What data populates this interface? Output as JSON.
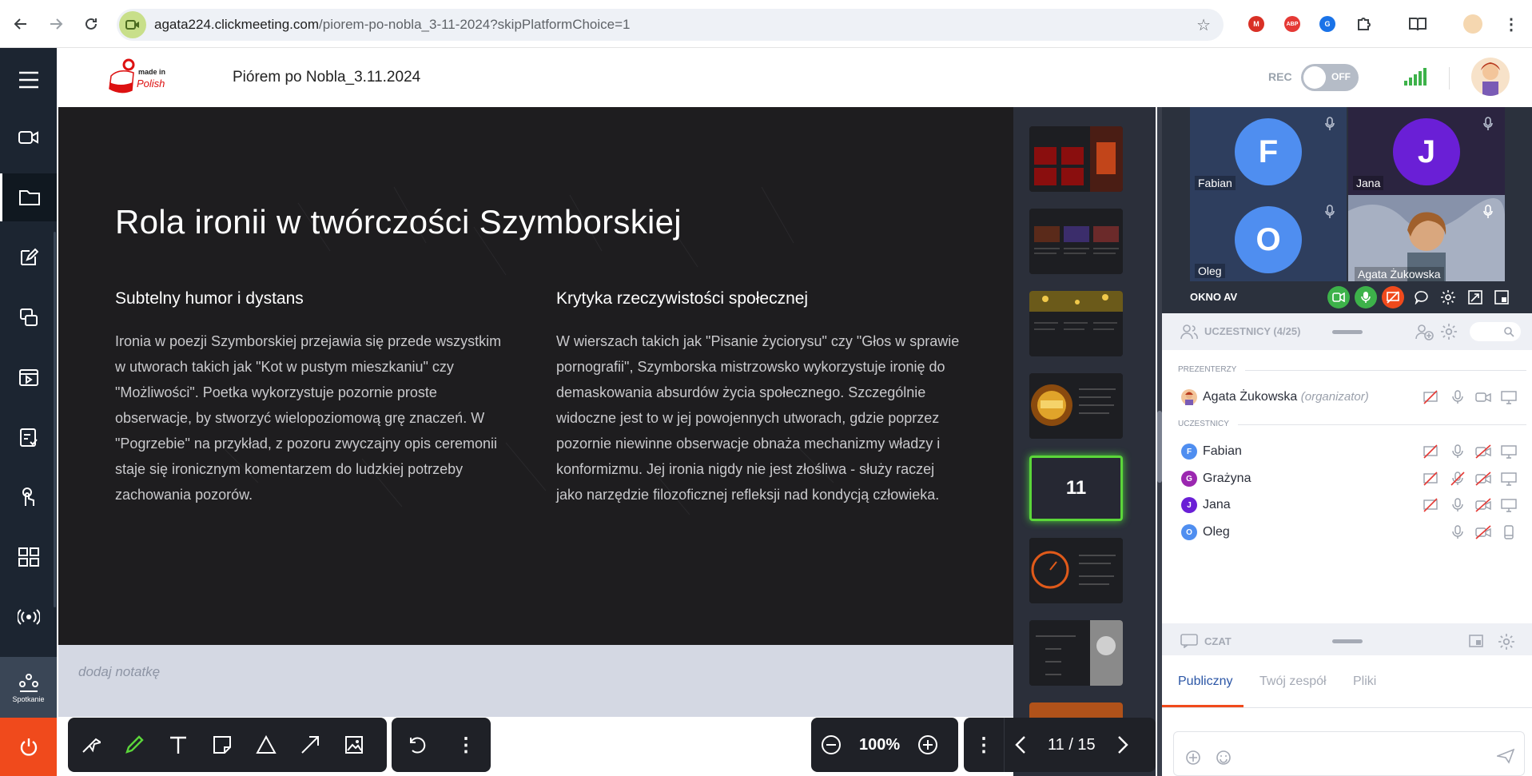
{
  "browser": {
    "url_host": "agata224.clickmeeting.com",
    "url_path": "/piorem-po-nobla_3-11-2024?skipPlatformChoice=1",
    "extensions": [
      {
        "name": "gmail-icon",
        "label": "M",
        "color": "#d93025"
      },
      {
        "name": "adblock-icon",
        "label": "ABP",
        "color": "#e53935"
      },
      {
        "name": "translate-icon",
        "label": "G",
        "color": "#1a73e8"
      }
    ]
  },
  "header": {
    "logo_text_top": "made in",
    "logo_text_bottom": "Polish",
    "meeting_title": "Piórem po Nobla_3.11.2024",
    "rec_label": "REC",
    "rec_state": "OFF"
  },
  "sidebar": {
    "spotkanie_label": "Spotkanie"
  },
  "slide": {
    "title": "Rola ironii w twórczości Szymborskiej",
    "left_heading": "Subtelny humor i dystans",
    "left_body": "Ironia w poezji Szymborskiej przejawia się przede wszystkim w utworach takich jak \"Kot w pustym mieszkaniu\" czy \"Możliwości\". Poetka wykorzystuje pozornie proste obserwacje, by stworzyć wielopoziomową grę znaczeń. W \"Pogrzebie\" na przykład, z pozoru zwyczajny opis ceremonii staje się ironicznym komentarzem do ludzkiej potrzeby zachowania pozorów.",
    "right_heading": "Krytyka rzeczywistości społecznej",
    "right_body": "W wierszach takich jak \"Pisanie życiorysu\" czy \"Głos w sprawie pornografii\", Szymborska mistrzowsko wykorzystuje ironię do demaskowania absurdów życia społecznego. Szczególnie widoczne jest to w jej powojennych utworach, gdzie poprzez pozornie niewinne obserwacje obnaża mechanizmy władzy i konformizmu. Jej ironia nigdy nie jest złośliwa - służy raczej jako narzędzie filozoficznej refleksji nad kondycją człowieka."
  },
  "notes": {
    "placeholder": "dodaj notatkę"
  },
  "thumbnails": {
    "active_number": "11"
  },
  "zoom": {
    "value": "100%"
  },
  "pager": {
    "value": "11 / 15"
  },
  "av": {
    "tiles": [
      {
        "initial": "F",
        "name": "Fabian",
        "color": "#4f8ef0"
      },
      {
        "initial": "J",
        "name": "Jana",
        "color": "#6a1fd6"
      },
      {
        "initial": "O",
        "name": "Oleg",
        "color": "#4f8ef0"
      },
      {
        "initial": "",
        "name": "Agata Żukowska",
        "color": ""
      }
    ],
    "okno_label": "OKNO AV"
  },
  "participants": {
    "header": "UCZESTNICY (4/25)",
    "presenters_label": "PREZENTERZY",
    "participants_label": "UCZESTNICY",
    "organizer_name": "Agata Żukowska",
    "organizer_role": "(organizator)",
    "list": [
      {
        "initial": "F",
        "name": "Fabian",
        "color": "#4f8ef0"
      },
      {
        "initial": "G",
        "name": "Grażyna",
        "color": "#9b27b0"
      },
      {
        "initial": "J",
        "name": "Jana",
        "color": "#6a1fd6"
      },
      {
        "initial": "O",
        "name": "Oleg",
        "color": "#4f8ef0"
      }
    ]
  },
  "chat": {
    "header": "CZAT",
    "tabs": [
      "Publiczny",
      "Twój zespół",
      "Pliki"
    ]
  },
  "colors": {
    "sidebar": "#1c2531",
    "accent_orange": "#f04a1c",
    "active_green": "#5bd63a",
    "stage": "#1e1d1f"
  }
}
